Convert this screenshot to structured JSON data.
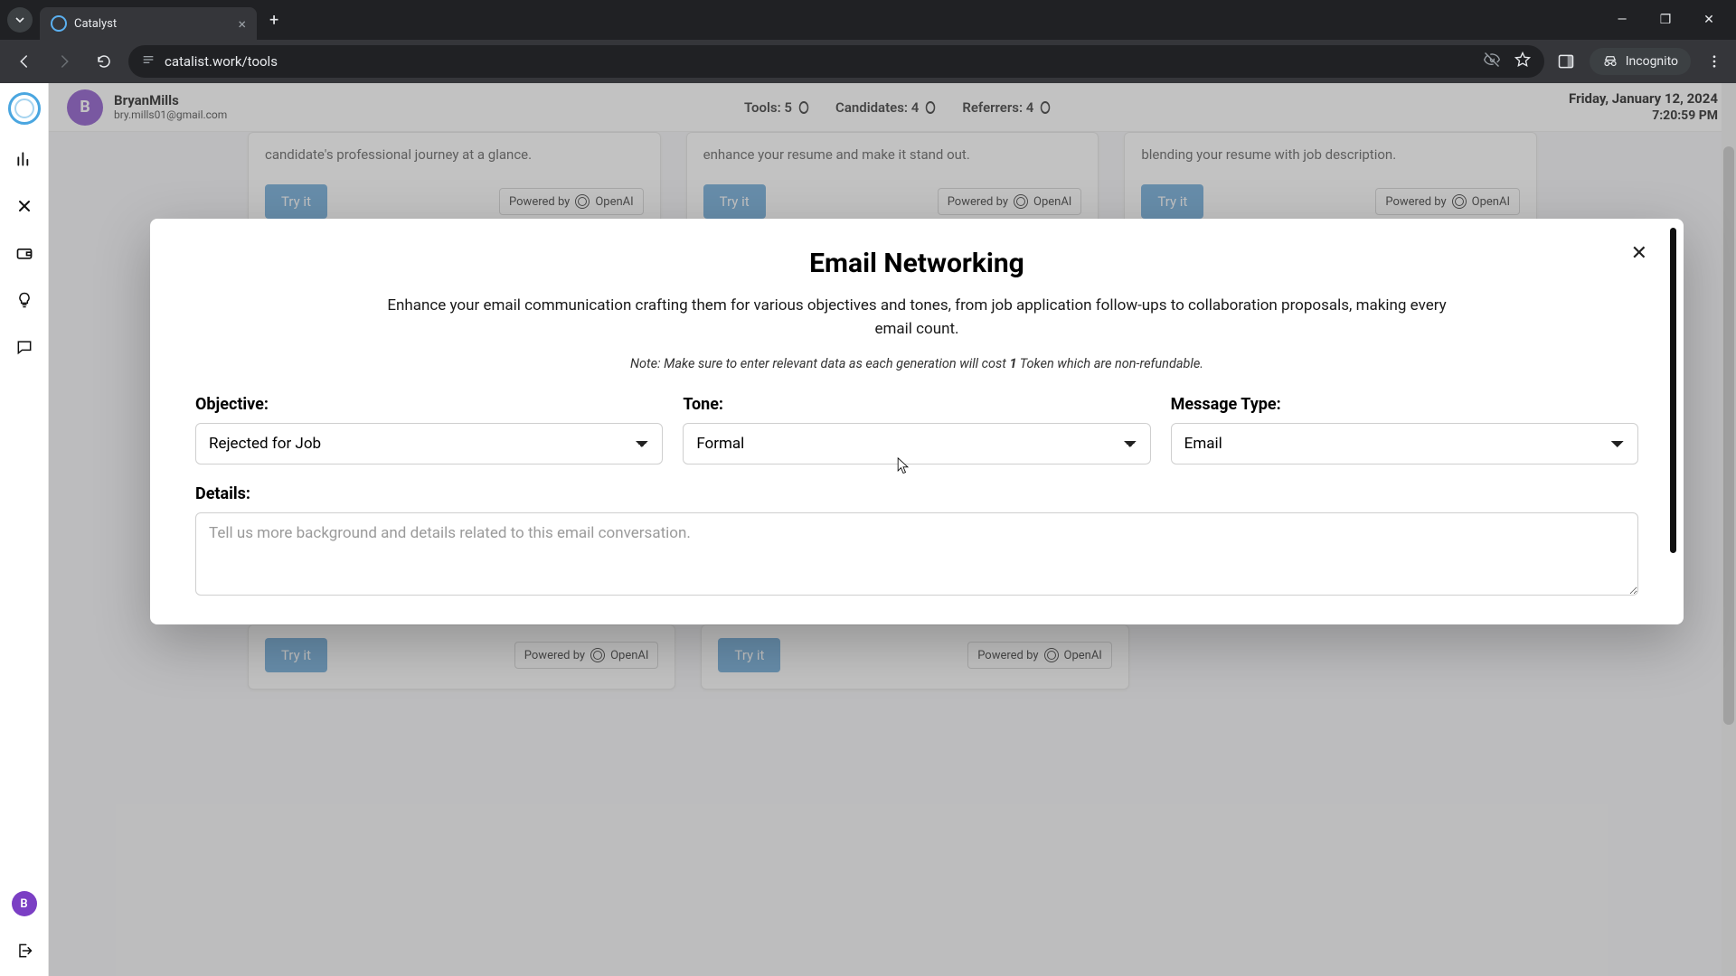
{
  "browser": {
    "tab_title": "Catalyst",
    "url": "catalist.work/tools",
    "incognito_label": "Incognito"
  },
  "header": {
    "avatar_initial": "B",
    "user_name": "BryanMills",
    "user_email": "bry.mills01@gmail.com",
    "stats": {
      "tools_label": "Tools: 5",
      "candidates_label": "Candidates: 4",
      "referrers_label": "Referrers: 4"
    },
    "date": "Friday, January 12, 2024",
    "time": "7:20:59 PM"
  },
  "cards_upper": [
    {
      "snippet": "candidate's professional journey at a glance.",
      "try": "Try it",
      "powered_prefix": "Powered by",
      "powered_brand": "OpenAI"
    },
    {
      "snippet": "enhance your resume and make it stand out.",
      "try": "Try it",
      "powered_prefix": "Powered by",
      "powered_brand": "OpenAI"
    },
    {
      "snippet": "blending your resume with job description.",
      "try": "Try it",
      "powered_prefix": "Powered by",
      "powered_brand": "OpenAI"
    }
  ],
  "cards_lower": [
    {
      "try": "Try it",
      "powered_prefix": "Powered by",
      "powered_brand": "OpenAI"
    },
    {
      "try": "Try it",
      "powered_prefix": "Powered by",
      "powered_brand": "OpenAI"
    }
  ],
  "modal": {
    "title": "Email Networking",
    "description": "Enhance your email communication crafting them for various objectives and tones, from job application follow-ups to collaboration proposals, making every email count.",
    "note_prefix": "Note: Make sure to enter relevant data as each generation will cost ",
    "note_bold": "1",
    "note_suffix": " Token which are non-refundable.",
    "labels": {
      "objective": "Objective:",
      "tone": "Tone:",
      "message_type": "Message Type:",
      "details": "Details:"
    },
    "values": {
      "objective": "Rejected for Job",
      "tone": "Formal",
      "message_type": "Email"
    },
    "details_placeholder": "Tell us more background and details related to this email conversation.",
    "close_glyph": "✕"
  },
  "left_rail": {
    "avatar_initial": "B"
  }
}
